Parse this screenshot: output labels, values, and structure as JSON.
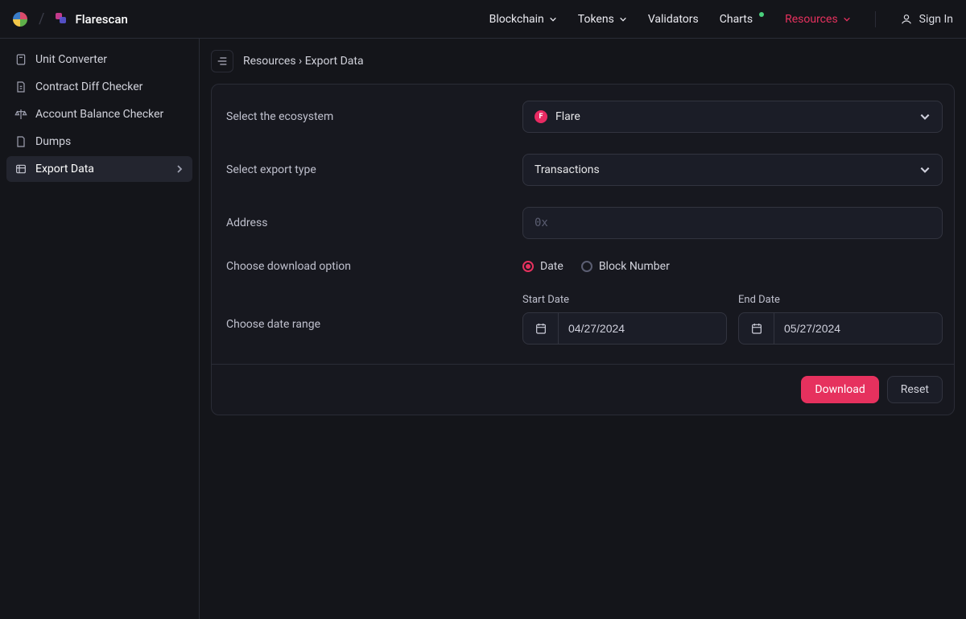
{
  "brand": {
    "name": "Flarescan"
  },
  "nav": {
    "blockchain": "Blockchain",
    "tokens": "Tokens",
    "validators": "Validators",
    "charts": "Charts",
    "resources": "Resources",
    "sign_in": "Sign In"
  },
  "sidebar": {
    "items": [
      {
        "label": "Unit Converter"
      },
      {
        "label": "Contract Diff Checker"
      },
      {
        "label": "Account Balance Checker"
      },
      {
        "label": "Dumps"
      },
      {
        "label": "Export Data"
      }
    ]
  },
  "breadcrumb": {
    "text": "Resources › Export Data"
  },
  "form": {
    "ecosystem_label": "Select the ecosystem",
    "ecosystem_value": "Flare",
    "export_type_label": "Select export type",
    "export_type_value": "Transactions",
    "address_label": "Address",
    "address_placeholder": "0x",
    "download_option_label": "Choose download option",
    "download_options": {
      "date": "Date",
      "block_number": "Block Number",
      "selected": "date"
    },
    "date_range_label": "Choose date range",
    "start_date_label": "Start Date",
    "start_date_value": "04/27/2024",
    "end_date_label": "End Date",
    "end_date_value": "05/27/2024"
  },
  "buttons": {
    "download": "Download",
    "reset": "Reset"
  }
}
